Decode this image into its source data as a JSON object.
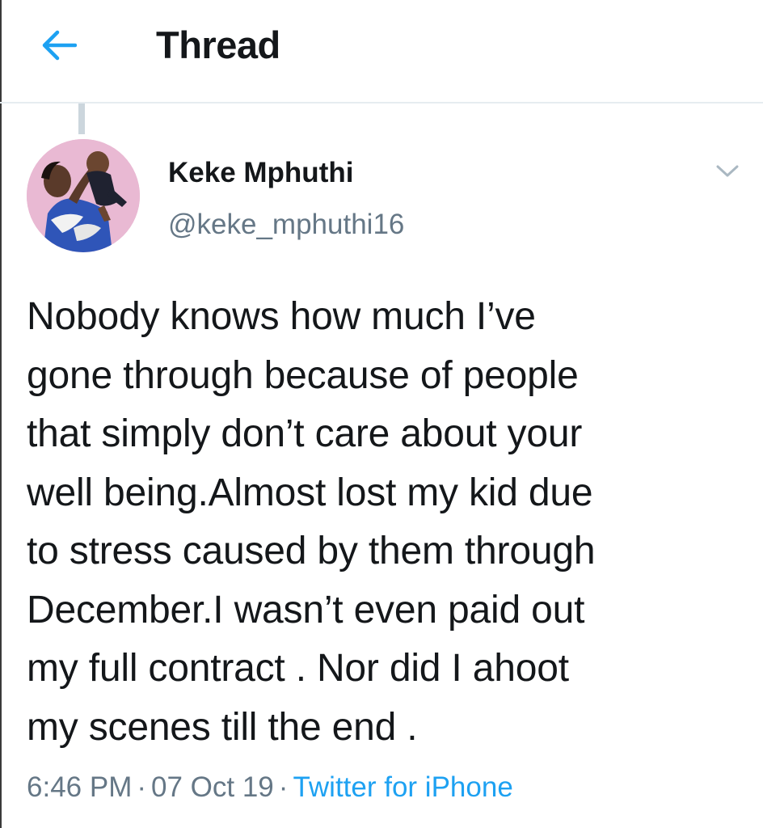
{
  "header": {
    "title": "Thread",
    "back_icon": "arrow-left-icon"
  },
  "tweet": {
    "author_name": "Keke Mphuthi",
    "author_handle": "@keke_mphuthi16",
    "text": "Nobody knows how much I’ve\ngone through because of people\nthat simply don’t care about your\nwell being.Almost lost my kid due\nto stress caused by them through\nDecember.I wasn’t even paid out\nmy full contract . Nor did I ahoot\nmy scenes till the end .",
    "time": "6:46 PM",
    "date": "07 Oct 19",
    "separator": "·",
    "source": "Twitter for iPhone",
    "more_icon": "chevron-down-icon"
  },
  "colors": {
    "accent": "#1da1f2",
    "secondary_text": "#657786",
    "primary_text": "#14171a",
    "divider": "#e6ecf0"
  }
}
